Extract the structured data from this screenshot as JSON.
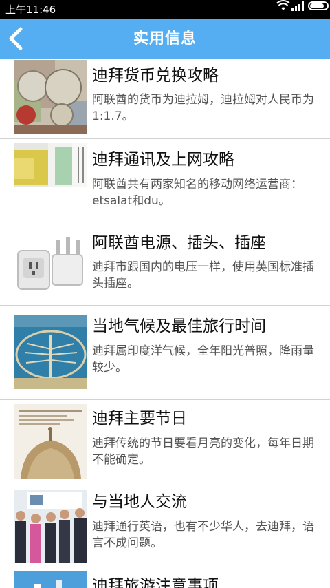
{
  "status_bar": {
    "time": "上午11:46",
    "icons": [
      "wifi-icon",
      "signal-icon",
      "battery-icon"
    ]
  },
  "header": {
    "title": "实用信息",
    "back_icon": "chevron-left-icon",
    "color": "#55aef2"
  },
  "items": [
    {
      "title": "迪拜货币兑换攻略",
      "desc": "阿联酋的货币为迪拉姆，迪拉姆对人民币为1:1.7。",
      "thumb": "currency-coins-image"
    },
    {
      "title": "迪拜通讯及上网攻略",
      "desc": "阿联酋共有两家知名的移动网络运营商：etsalat和du。",
      "thumb": "sim-card-image"
    },
    {
      "title": "阿联酋电源、插头、插座",
      "desc": "迪拜市跟国内的电压一样，使用英国标准插头插座。",
      "thumb": "power-adapter-image"
    },
    {
      "title": "当地气候及最佳旅行时间",
      "desc": "迪拜属印度洋气候，全年阳光普照，降雨量较少。",
      "thumb": "palm-island-image"
    },
    {
      "title": "迪拜主要节日",
      "desc": "迪拜传统的节日要看月亮的变化，每年日期不能确定。",
      "thumb": "mosque-dome-image"
    },
    {
      "title": "与当地人交流",
      "desc": "迪拜通行英语，也有不少华人，去迪拜，语言不成问题。",
      "thumb": "people-group-image"
    },
    {
      "title": "迪拜旅游注意事项",
      "desc": "",
      "thumb": "city-sky-image"
    }
  ]
}
